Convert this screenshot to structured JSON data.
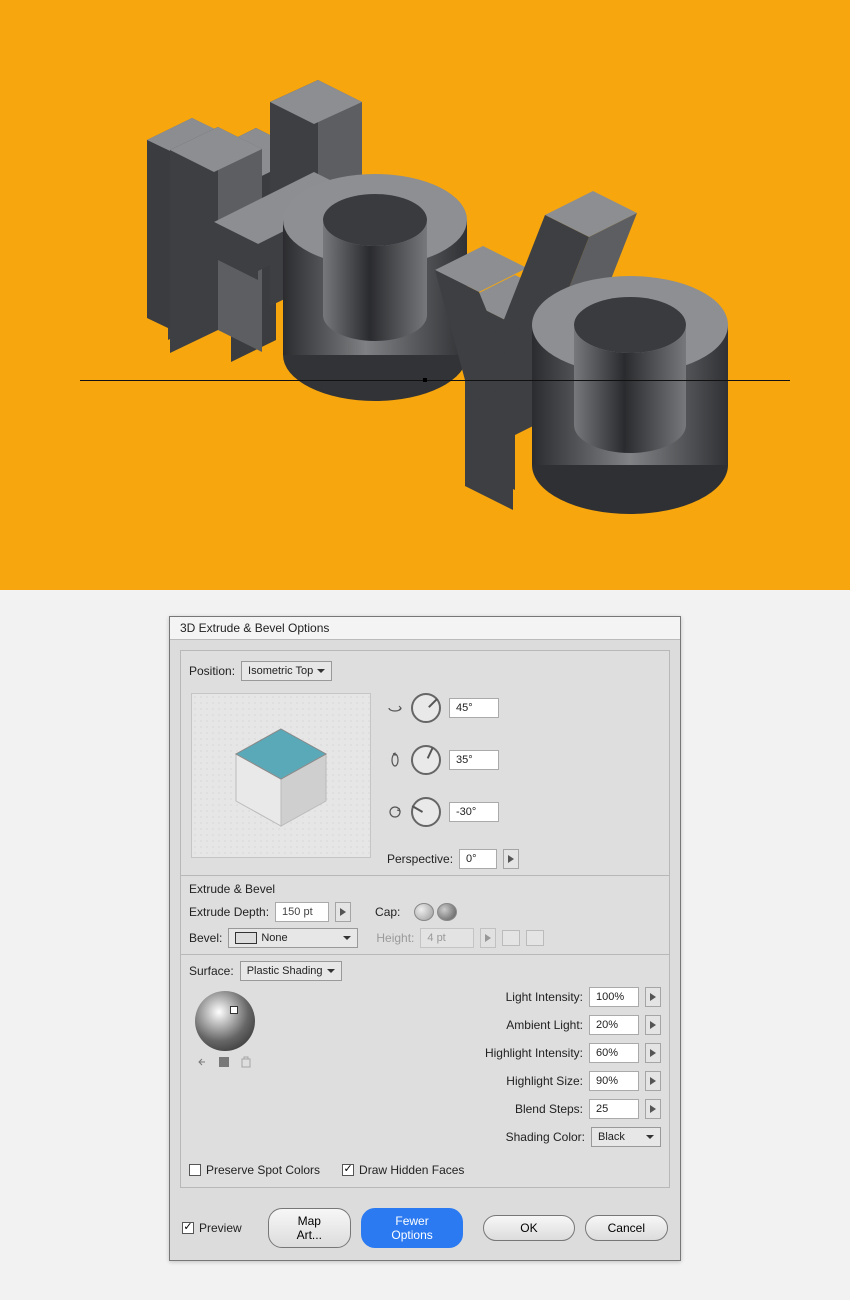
{
  "dialog": {
    "title": "3D Extrude & Bevel Options",
    "position_label": "Position:",
    "position_value": "Isometric Top",
    "rotation": {
      "x": "45°",
      "y": "35°",
      "z": "-30°"
    },
    "perspective_label": "Perspective:",
    "perspective_value": "0°",
    "extrude": {
      "section_label": "Extrude & Bevel",
      "depth_label": "Extrude Depth:",
      "depth_value": "150 pt",
      "cap_label": "Cap:",
      "bevel_label": "Bevel:",
      "bevel_value": "None",
      "height_label": "Height:",
      "height_value": "4 pt"
    },
    "surface": {
      "label": "Surface:",
      "value": "Plastic Shading",
      "light_intensity_label": "Light Intensity:",
      "light_intensity_value": "100%",
      "ambient_label": "Ambient Light:",
      "ambient_value": "20%",
      "highlight_intensity_label": "Highlight Intensity:",
      "highlight_intensity_value": "60%",
      "highlight_size_label": "Highlight Size:",
      "highlight_size_value": "90%",
      "blend_steps_label": "Blend Steps:",
      "blend_steps_value": "25",
      "shading_color_label": "Shading Color:",
      "shading_color_value": "Black",
      "preserve_spot_label": "Preserve Spot Colors",
      "draw_hidden_label": "Draw Hidden Faces"
    },
    "footer": {
      "preview_label": "Preview",
      "map_art": "Map Art...",
      "fewer_options": "Fewer Options",
      "ok": "OK",
      "cancel": "Cancel"
    }
  }
}
